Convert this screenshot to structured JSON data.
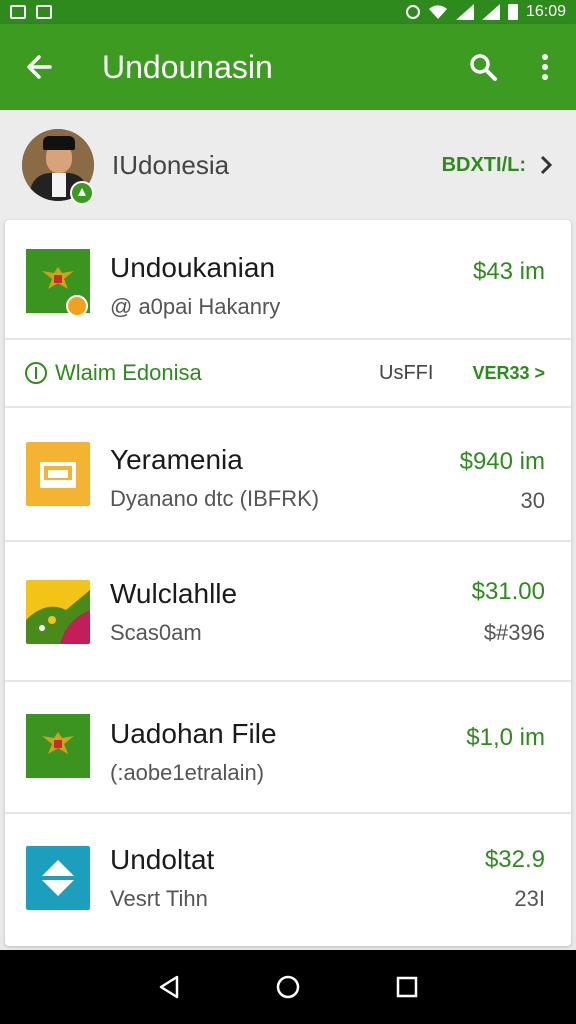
{
  "status_bar": {
    "time": "16:09",
    "icons": [
      "notification-icon",
      "gallery-icon",
      "alarm-icon",
      "wifi-icon",
      "signal-icon",
      "signal-icon",
      "battery-icon"
    ]
  },
  "app_bar": {
    "title": "Undounasin",
    "back_icon": "arrow-back-icon",
    "search_icon": "search-icon",
    "menu_icon": "more-vert-icon"
  },
  "profile": {
    "name": "IUdonesia",
    "action_label": "BDXTI/L:"
  },
  "rows": [
    {
      "title": "Undoukanian",
      "subtitle": "@ a0pai Hakanry",
      "price": "$43 im",
      "thumb": "emblem"
    },
    {
      "title": "Yeramenia",
      "subtitle": "Dyanano dtc (IBFRK)",
      "price": "$940 im",
      "qty": "30",
      "thumb": "orange"
    },
    {
      "title": "Wulclahlle",
      "subtitle": "Scas0am",
      "price": "$31.00",
      "qty": "$#396",
      "thumb": "multicolor"
    },
    {
      "title": "Uadohan File",
      "subtitle": "(:aobe1etralain)",
      "price": "$1,0 im",
      "thumb": "emblem"
    },
    {
      "title": "Undoltat",
      "subtitle": "Vesrt Tihn",
      "price": "$32.9",
      "qty": "23I",
      "thumb": "teal"
    }
  ],
  "filter_bar": {
    "left_label": "Wlaim Edonisa",
    "mid_label": "UsFFI",
    "right_label": "VER33 >"
  },
  "colors": {
    "app_bar": "#3d9b22",
    "status_bar": "#2f8a1e",
    "accent_green": "#2f8a1e",
    "orange": "#f4b331",
    "teal": "#1c9fbd"
  }
}
